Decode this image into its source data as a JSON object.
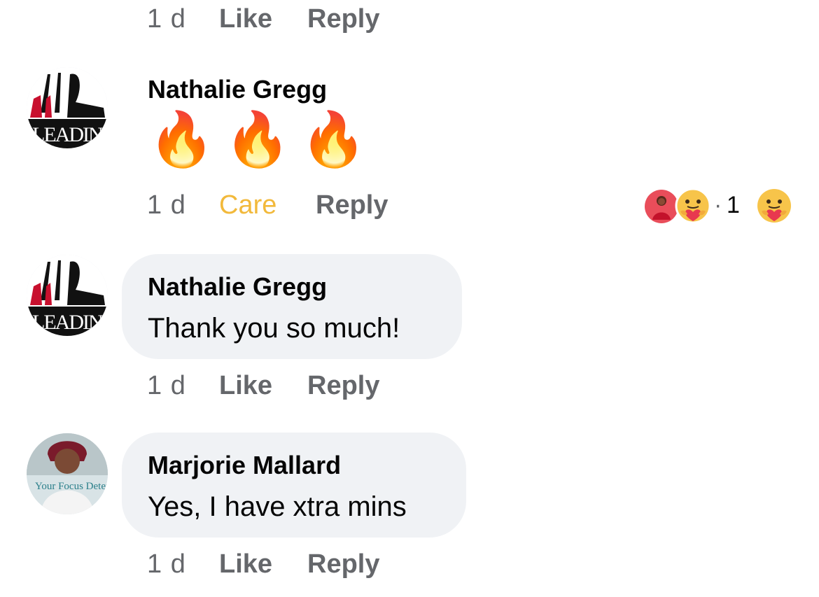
{
  "top_meta": {
    "time": "1 d",
    "like": "Like",
    "reply": "Reply"
  },
  "comments": [
    {
      "author": "Nathalie Gregg",
      "avatar_text": "LEADING",
      "content": "🔥🔥🔥",
      "time": "1 d",
      "reaction_label": "Care",
      "reply": "Reply",
      "reactions": {
        "separator": "·",
        "count": "1",
        "icons": [
          "profile-photo",
          "care-emoji"
        ]
      }
    },
    {
      "author": "Nathalie Gregg",
      "avatar_text": "LEADING",
      "content": "Thank you so much!",
      "time": "1 d",
      "like": "Like",
      "reply": "Reply"
    },
    {
      "author": "Marjorie Mallard",
      "avatar_text": "Your Focus Determines",
      "content": "Yes, I have xtra mins",
      "time": "1 d",
      "like": "Like",
      "reply": "Reply"
    }
  ],
  "colors": {
    "secondary_text": "#65676b",
    "care": "#f2b93b",
    "bubble": "#f0f2f5"
  }
}
